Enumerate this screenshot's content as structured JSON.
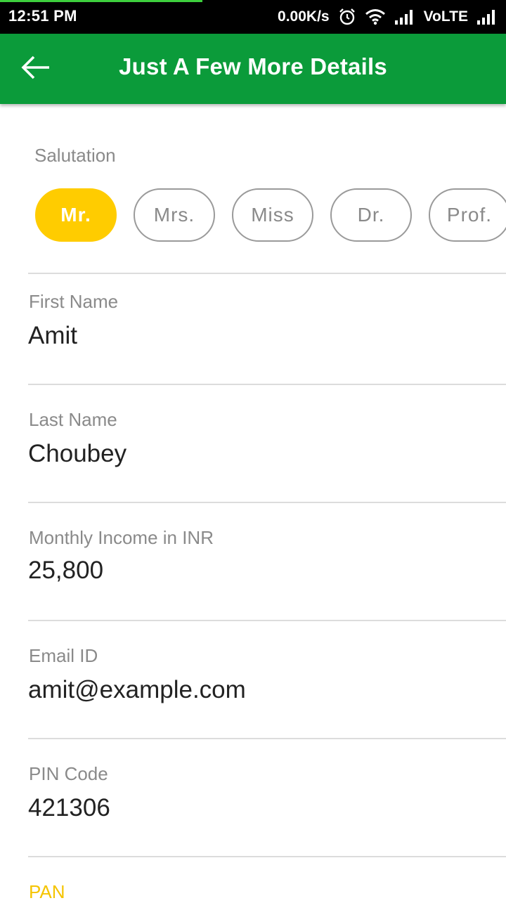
{
  "status_bar": {
    "time": "12:51 PM",
    "network_speed": "0.00K/s",
    "network_type": "VoLTE"
  },
  "header": {
    "title": "Just A Few More Details"
  },
  "salutation": {
    "label": "Salutation",
    "options": [
      "Mr.",
      "Mrs.",
      "Miss",
      "Dr.",
      "Prof."
    ],
    "selected": "Mr."
  },
  "fields": {
    "first_name": {
      "label": "First Name",
      "value": "Amit"
    },
    "last_name": {
      "label": "Last Name",
      "value": "Choubey"
    },
    "monthly_income": {
      "label": "Monthly Income in INR",
      "value": "25,800"
    },
    "email": {
      "label": "Email ID",
      "value": "amit@example.com"
    },
    "pin_code": {
      "label": "PIN Code",
      "value": "421306"
    },
    "pan": {
      "label": "PAN"
    }
  },
  "colors": {
    "app_bar": "#0b9b3a",
    "accent": "#ffcc00",
    "active_label": "#f5c400"
  }
}
